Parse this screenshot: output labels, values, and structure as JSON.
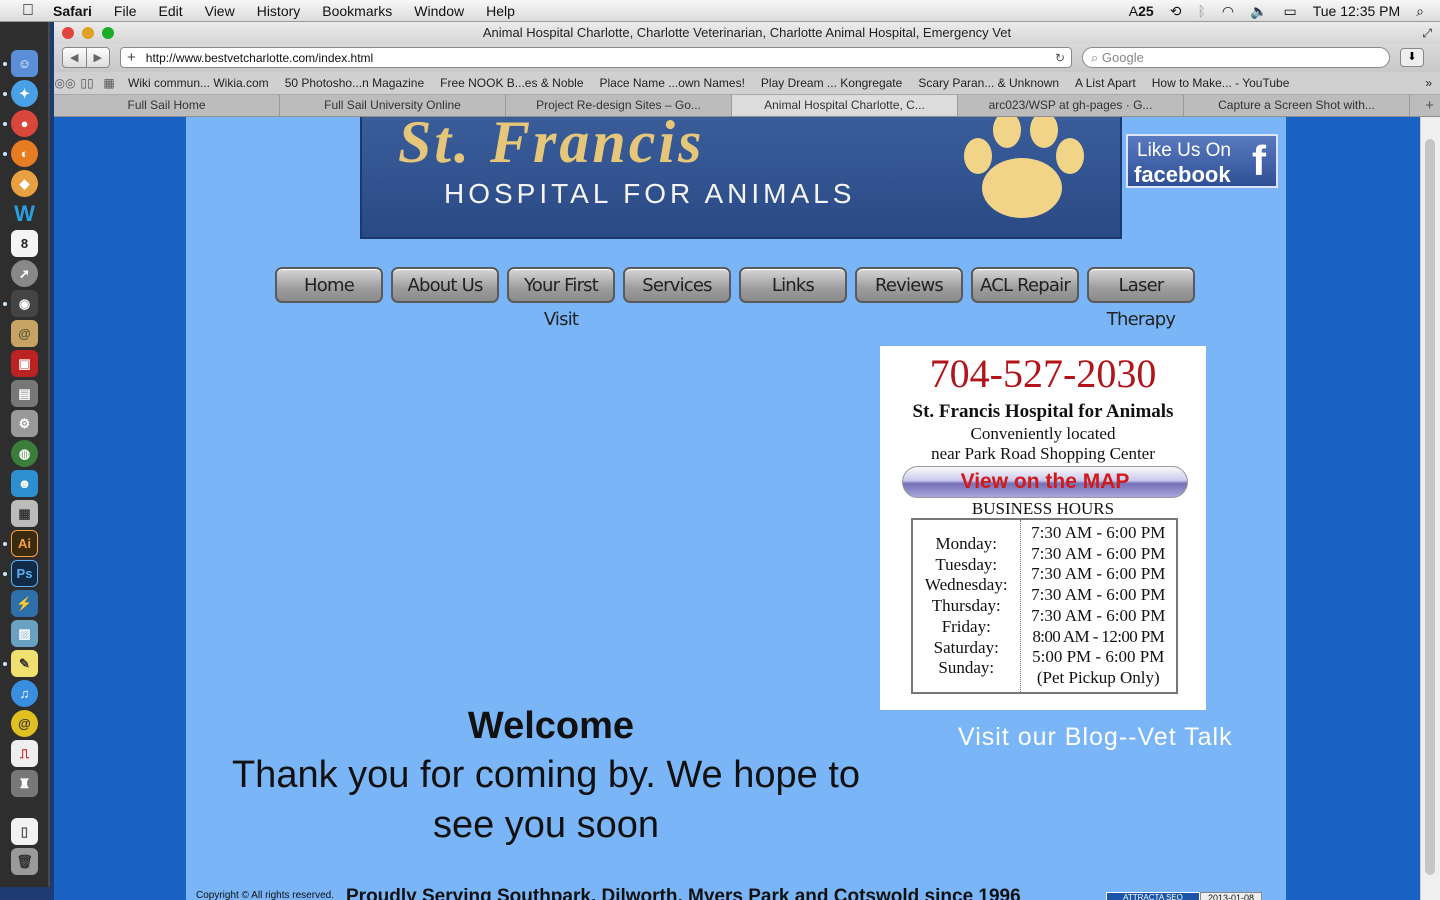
{
  "menubar": {
    "apple": "",
    "app": "Safari",
    "items": [
      "File",
      "Edit",
      "View",
      "History",
      "Bookmarks",
      "Window",
      "Help"
    ],
    "status": {
      "ai_count": "25",
      "clock": "Tue 12:35 PM"
    }
  },
  "window": {
    "title": "Animal Hospital Charlotte, Charlotte Veterinarian, Charlotte Animal Hospital, Emergency Vet",
    "url": "http://www.bestvetcharlotte.com/index.html",
    "search_placeholder": "Google",
    "nav_back": "◀",
    "nav_forward": "▶",
    "reload": "↻"
  },
  "bookmarks": [
    "Wiki commun... Wikia.com",
    "50 Photosho...n Magazine",
    "Free NOOK B...es & Noble",
    "Place Name ...own Names!",
    "Play Dream ... Kongregate",
    "Scary Paran... & Unknown",
    "A List Apart",
    "How to Make... - YouTube"
  ],
  "tabs": [
    {
      "label": "Full Sail Home",
      "active": false
    },
    {
      "label": "Full Sail University Online",
      "active": false
    },
    {
      "label": "Project Re-design Sites – Go...",
      "active": false
    },
    {
      "label": "Animal Hospital Charlotte, C...",
      "active": true
    },
    {
      "label": "arc023/WSP at gh-pages · G...",
      "active": false
    },
    {
      "label": "Capture a Screen Shot with...",
      "active": false
    }
  ],
  "site": {
    "logo_title": "St. Francis",
    "logo_subtitle": "HOSPITAL FOR ANIMALS",
    "fb_line1": "Like Us On",
    "fb_line2": "facebook",
    "fb_glyph": "f",
    "nav": [
      "Home",
      "About Us",
      "Your First Visit",
      "Services",
      "Links",
      "Reviews",
      "ACL Repair",
      "Laser Therapy"
    ],
    "info": {
      "phone": "704-527-2030",
      "name": "St. Francis Hospital for Animals",
      "loc1": "Conveniently located",
      "loc2": "near Park Road Shopping Center",
      "map_button": "View on the MAP",
      "hours_title": "BUSINESS HOURS",
      "hours": [
        {
          "day": "Monday:",
          "time": "7:30 AM - 6:00 PM"
        },
        {
          "day": "Tuesday:",
          "time": "7:30 AM - 6:00 PM"
        },
        {
          "day": "Wednesday:",
          "time": "7:30 AM - 6:00 PM"
        },
        {
          "day": "Thursday:",
          "time": "7:30 AM - 6:00 PM"
        },
        {
          "day": "Friday:",
          "time": "7:30 AM - 6:00 PM"
        },
        {
          "day": "Saturday:",
          "time": "8:00 AM - 12:00 PM"
        },
        {
          "day": "Sunday:",
          "time": "5:00 PM - 6:00 PM"
        },
        {
          "day": "",
          "time": "(Pet Pickup Only)"
        }
      ]
    },
    "blog_link": "Visit our Blog--Vet Talk",
    "welcome_heading": "Welcome",
    "welcome_text": "Thank you for coming by. We hope to see you soon",
    "copyright": "Copyright © All rights reserved.",
    "serving": "Proudly Serving Southpark, Dilworth, Myers Park and Cotswold since 1996",
    "seo_badge": "ATTRACTA SEO",
    "seo_date": "2013-01-08"
  },
  "colors": {
    "page_bg": "#1a62c4",
    "content_bg": "#7ab6f7",
    "phone": "#b3141a",
    "map_text": "#d11a1a"
  }
}
